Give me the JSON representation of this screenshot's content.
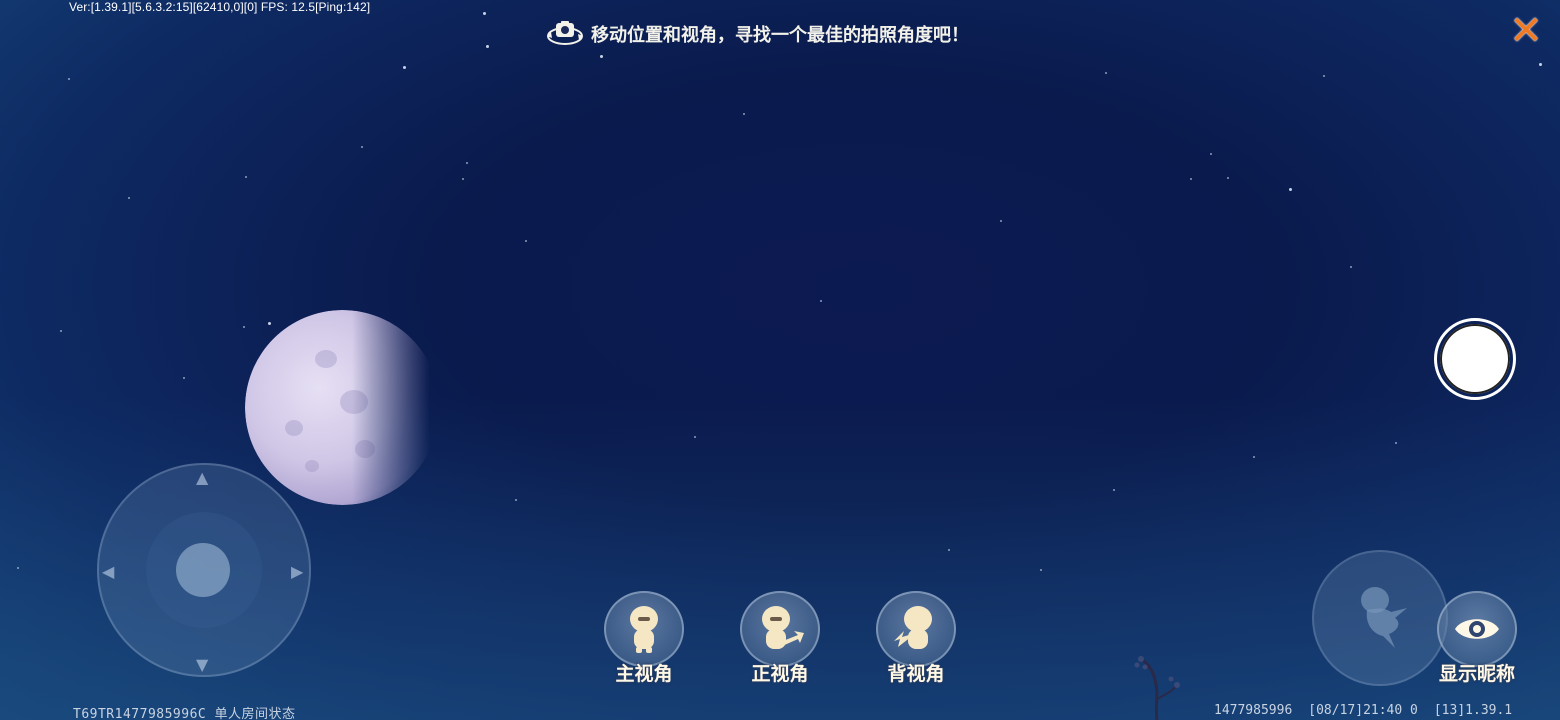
{
  "hud": {
    "version_text": "Ver:[1.39.1][5.6.3.2:15][62410,0][0] FPS: 12.5[Ping:142]",
    "hint_text": "移动位置和视角，寻找一个最佳的拍照角度吧！",
    "close_icon": "close-x-icon",
    "close_color": "#f07a24"
  },
  "camera_views": [
    {
      "label": "主视角",
      "icon": "main-view-character-icon"
    },
    {
      "label": "正视角",
      "icon": "front-view-character-icon"
    },
    {
      "label": "背视角",
      "icon": "back-view-character-icon"
    }
  ],
  "controls": {
    "shutter_icon": "shutter-circle-icon",
    "jump_icon": "jump-character-icon",
    "nickname_label": "显示昵称",
    "nickname_icon": "eye-icon"
  },
  "footer": {
    "room_status": "T69TR1477985996C 单人房间状态",
    "player_id": "1477985996",
    "timestamp": "[08/17]21:40 0",
    "build": "[13]1.39.1"
  }
}
